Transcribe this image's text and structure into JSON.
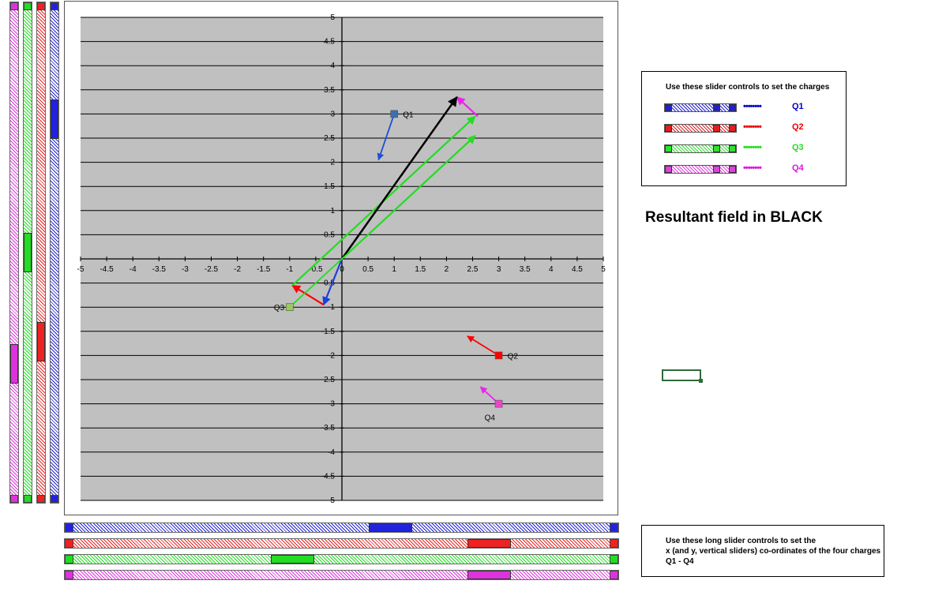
{
  "chart_data": {
    "type": "scatter",
    "xlim": [
      -5,
      5
    ],
    "ylim": [
      -5,
      5
    ],
    "x_ticks": [
      "-5",
      "-4.5",
      "-4",
      "-3.5",
      "-3",
      "-2.5",
      "-2",
      "-1.5",
      "-1",
      "-0.5",
      "0",
      "0.5",
      "1",
      "1.5",
      "2",
      "2.5",
      "3",
      "3.5",
      "4",
      "4.5",
      "5"
    ],
    "y_ticks": [
      "5",
      "4.5",
      "4",
      "3.5",
      "3",
      "2.5",
      "2",
      "1.5",
      "1",
      "0.5",
      "0",
      "-0.5",
      "-1",
      "-1.5",
      "-2",
      "-2.5",
      "-3",
      "-3.5",
      "-4",
      "-4.5",
      "-5"
    ],
    "grid": true,
    "background": "#c0c0c0",
    "charges": [
      {
        "label": "Q1",
        "x": 1,
        "y": 3,
        "color": "#3a6fb0",
        "arrow_color": "#1e4fd8",
        "arrow_to": [
          0.7,
          2.05
        ]
      },
      {
        "label": "Q2",
        "x": 3,
        "y": -2,
        "color": "#ff0000",
        "arrow_color": "#ff0000",
        "arrow_to": [
          2.4,
          -1.6
        ]
      },
      {
        "label": "Q3",
        "x": -1,
        "y": -1,
        "color": "#9bc85f",
        "arrow_color": "#22dd22",
        "arrow_to": [
          2.55,
          2.55
        ]
      },
      {
        "label": "Q4",
        "x": 3,
        "y": -3,
        "color": "#ee44cc",
        "arrow_color": "#ee22ee",
        "arrow_to": [
          2.65,
          -2.65
        ]
      }
    ],
    "field_vectors": [
      {
        "name": "Q3 field",
        "color": "#22dd22",
        "x1": 0,
        "y1": 0,
        "x2": 2.55,
        "y2": 2.55
      },
      {
        "name": "Q1 field",
        "color": "#1e3fd8",
        "x1": 0,
        "y1": 0,
        "x2": -0.35,
        "y2": -0.95
      },
      {
        "name": "Q2 field",
        "color": "#ff0000",
        "x1": -0.35,
        "y1": -0.95,
        "x2": -0.95,
        "y2": -0.55
      },
      {
        "name": "Q3 field",
        "color": "#22dd22",
        "x1": -0.95,
        "y1": -0.55,
        "x2": 2.55,
        "y2": 2.95
      },
      {
        "name": "Q4 field",
        "color": "#ee22ee",
        "x1": 2.6,
        "y1": 2.95,
        "x2": 2.2,
        "y2": 3.35
      },
      {
        "name": "Resultant",
        "color": "#000000",
        "x1": 0,
        "y1": 0,
        "x2": 2.2,
        "y2": 3.35
      }
    ]
  },
  "legend_box": {
    "title": "Use these slider controls to set the charges",
    "rows": [
      {
        "label": "Q1",
        "dots": "••••••••",
        "color": "#0000cc",
        "fill": "#2020d0",
        "level": 0.83
      },
      {
        "label": "Q2",
        "dots": "••••••••",
        "color": "#ee0000",
        "fill": "#e02020",
        "level": 0.83
      },
      {
        "label": "Q3",
        "dots": "••••••••",
        "color": "#22dd22",
        "fill": "#30e030",
        "level": 0.83
      },
      {
        "label": "Q4",
        "dots": "••••••••",
        "color": "#dd11dd",
        "fill": "#e040e0",
        "level": 0.83
      }
    ]
  },
  "resultant_label": "Resultant field in BLACK",
  "info_box": {
    "line1": "Use these long slider controls to set the",
    "line2": "x (and y, vertical  sliders) co-ordinates of the four charges",
    "line3": "Q1 - Q4"
  },
  "vertical_sliders": [
    {
      "name": "q4-y-slider",
      "color": "#dd33dd",
      "level": 0.25
    },
    {
      "name": "q3-y-slider",
      "color": "#22dd22",
      "level": 0.5
    },
    {
      "name": "q2-y-slider",
      "color": "#ee2222",
      "level": 0.3
    },
    {
      "name": "q1-y-slider",
      "color": "#2222dd",
      "level": 0.8
    }
  ],
  "horizontal_sliders": [
    {
      "name": "q1-x-slider",
      "color": "#2222dd",
      "level": 0.6
    },
    {
      "name": "q2-x-slider",
      "color": "#ee2222",
      "level": 0.8
    },
    {
      "name": "q3-x-slider",
      "color": "#22dd22",
      "level": 0.4
    },
    {
      "name": "q4-x-slider",
      "color": "#dd33dd",
      "level": 0.8
    }
  ]
}
